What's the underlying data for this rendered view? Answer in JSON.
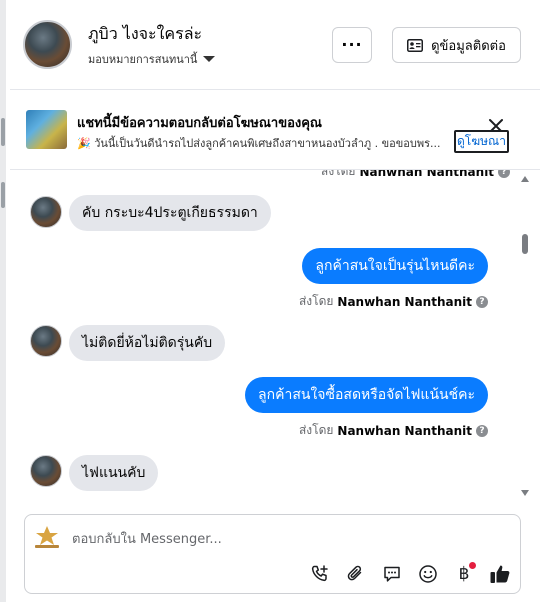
{
  "colors": {
    "accent": "#0a7cff",
    "link": "#0064d1",
    "incoming_bubble": "#e4e6eb",
    "notification": "#e41e3f"
  },
  "header": {
    "name": "ภูบิว ไงจะใครล่ะ",
    "assign_label": "มอบหมายการสนทนานี้",
    "more_label": "···",
    "contact_button": "ดูข้อมูลติดต่อ"
  },
  "ad": {
    "title": "แชทนี้มีข้อความตอบกลับต่อโฆษณาของคุณ",
    "description": "🎉 วันนี้เป็นวันดีนำรถไปส่งลูกค้าคนพิเศษถึงสาขาหนองบัวลำภู . ขอขอบพร...",
    "link_label": "ดูโฆษณา"
  },
  "messages": {
    "top_sent_by": {
      "prefix": "ส่งโดย",
      "name": "Nanwhan Nanthanit"
    },
    "items": [
      {
        "direction": "in",
        "text": "คับ กระบะ4ประตูเกียธรรมดา"
      },
      {
        "direction": "out",
        "text": "ลูกค้าสนใจเป็นรุ่นไหนดีคะ",
        "sent_by_prefix": "ส่งโดย",
        "sent_by_name": "Nanwhan Nanthanit"
      },
      {
        "direction": "in",
        "text": "ไม่ติดยี่ห้อไม่ติดรุ่นคับ"
      },
      {
        "direction": "out",
        "text": "ลูกค้าสนใจซื้อสดหรือจัดไฟแน้นช์คะ",
        "sent_by_prefix": "ส่งโดย",
        "sent_by_name": "Nanwhan Nanthanit"
      },
      {
        "direction": "in",
        "text": "ไฟแนนคับ"
      }
    ],
    "help_icon_glyph": "?"
  },
  "composer": {
    "placeholder": "ตอบกลับใน Messenger...",
    "icons": [
      "phone-plus-icon",
      "attachment-icon",
      "saved-reply-icon",
      "emoji-icon",
      "baht-payment-icon",
      "thumbs-up-icon"
    ],
    "baht_glyph": "฿"
  }
}
